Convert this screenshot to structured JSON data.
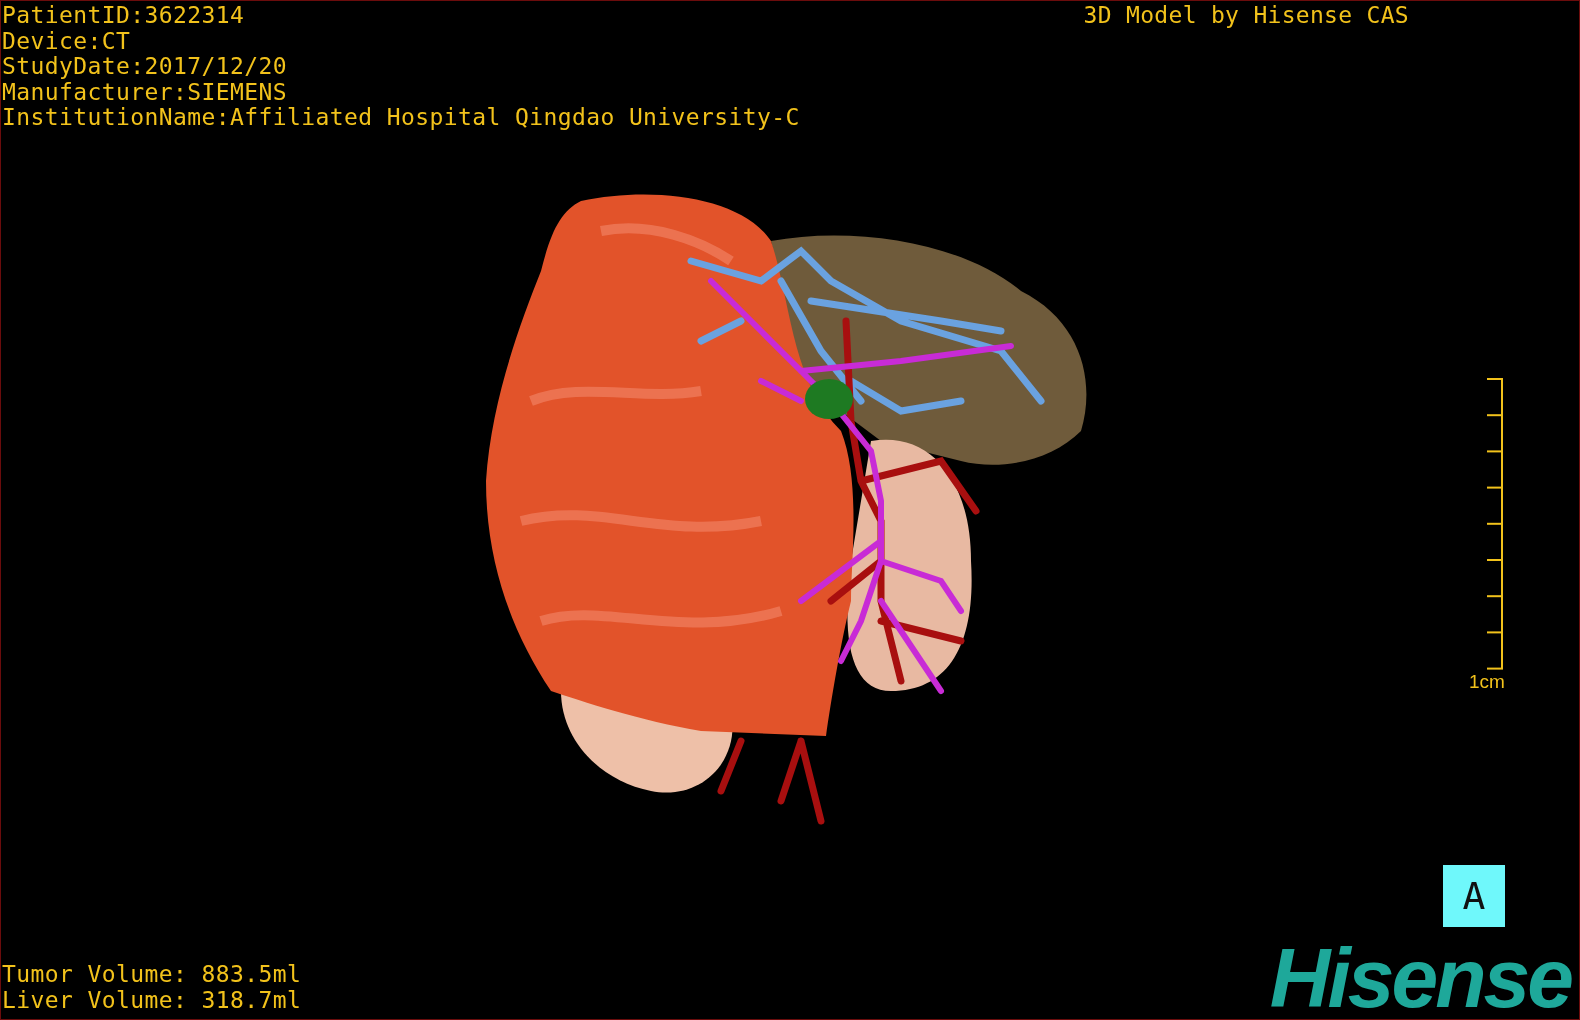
{
  "patient_info": [
    "PatientID:3622314",
    "Device:CT",
    "StudyDate:2017/12/20",
    "Manufacturer:SIEMENS",
    "InstitutionName:Affiliated Hospital Qingdao University-C"
  ],
  "title": "3D Model by Hisense CAS",
  "scale_bar": {
    "label": "1cm"
  },
  "volumes": [
    "Tumor Volume: 883.5ml",
    "Liver Volume: 318.7ml"
  ],
  "orientation": "A",
  "logo": "Hisense"
}
